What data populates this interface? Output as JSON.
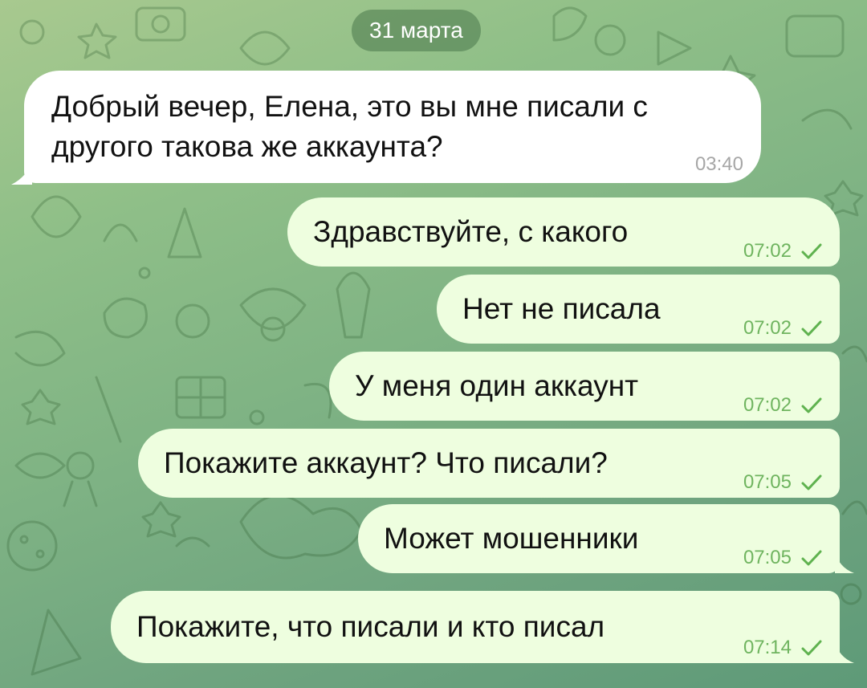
{
  "date_separator": "31 марта",
  "messages": [
    {
      "direction": "in",
      "text": "Добрый вечер, Елена, это вы мне писали с другого такова же аккаунта?",
      "time": "03:40"
    },
    {
      "direction": "out",
      "text": "Здравствуйте, с какого",
      "time": "07:02",
      "status_icon": "check-icon"
    },
    {
      "direction": "out",
      "text": "Нет не писала",
      "time": "07:02",
      "status_icon": "check-icon"
    },
    {
      "direction": "out",
      "text": "У меня один аккаунт",
      "time": "07:02",
      "status_icon": "check-icon"
    },
    {
      "direction": "out",
      "text": "Покажите аккаунт? Что писали?",
      "time": "07:05",
      "status_icon": "check-icon"
    },
    {
      "direction": "out",
      "text": "Может мошенники",
      "time": "07:05",
      "status_icon": "check-icon"
    },
    {
      "direction": "out",
      "text": "Покажите, что писали и кто писал",
      "time": "07:14",
      "status_icon": "check-icon"
    }
  ],
  "colors": {
    "background_top": "#a8c98f",
    "background_bottom": "#5e9a78",
    "incoming_bubble": "#ffffff",
    "outgoing_bubble": "#eefedf",
    "outgoing_meta": "#6fb45f",
    "incoming_meta": "#a6a6a6"
  }
}
